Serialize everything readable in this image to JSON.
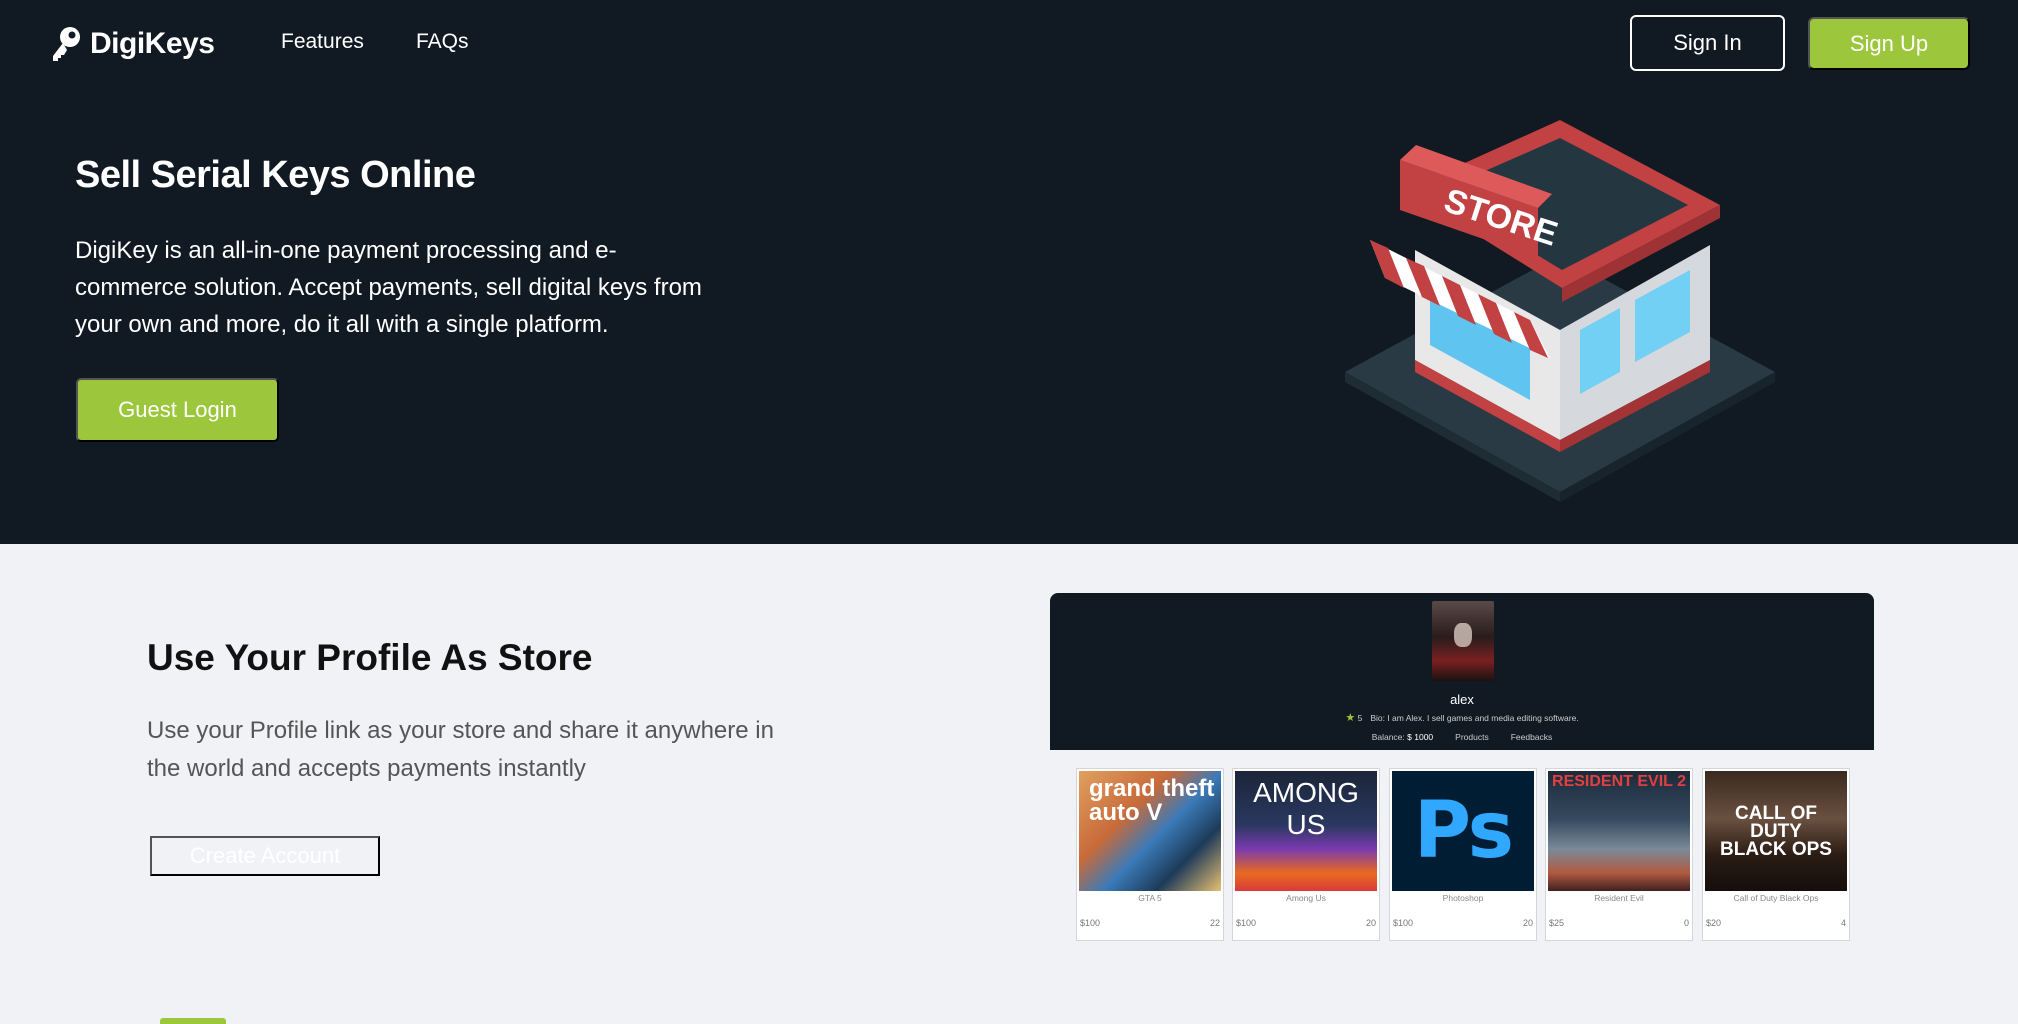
{
  "header": {
    "brand": "DigiKeys",
    "nav": [
      {
        "label": "Features"
      },
      {
        "label": "FAQs"
      }
    ],
    "signin_label": "Sign In",
    "signup_label": "Sign Up"
  },
  "hero": {
    "title": "Sell Serial Keys Online",
    "description": "DigiKey is an all-in-one payment processing and e-commerce solution. Accept payments, sell digital keys from your own and more, do it all with a single platform.",
    "guest_login_label": "Guest Login",
    "illustration_sign": "STORE"
  },
  "profile_section": {
    "title": "Use Your Profile As Store",
    "description": "Use your Profile link as your store and share it anywhere in the world and accepts payments instantly",
    "create_account_label": "Create Account"
  },
  "profile_preview": {
    "name": "alex",
    "rating": "5",
    "bio": "Bio: I am Alex. I sell games and media editing software.",
    "balance_label": "Balance:",
    "balance_value": "$ 1000",
    "products_link": "Products",
    "feedbacks_link": "Feedbacks",
    "products": [
      {
        "name": "GTA 5",
        "price": "$100",
        "count": "22",
        "cover_text": "grand theft auto V"
      },
      {
        "name": "Among Us",
        "price": "$100",
        "count": "20",
        "cover_text": "AMONG US"
      },
      {
        "name": "Photoshop",
        "price": "$100",
        "count": "20",
        "cover_text": "Ps"
      },
      {
        "name": "Resident Evil",
        "price": "$25",
        "count": "0",
        "cover_text": "RESIDENT EVIL 2"
      },
      {
        "name": "Call of Duty Black Ops",
        "price": "$20",
        "count": "4",
        "cover_text": "CALL OF DUTY BLACK OPS"
      }
    ]
  },
  "colors": {
    "hero_bg": "#111a23",
    "accent_green": "#9cc63c",
    "page_bg": "#f1f2f6"
  }
}
